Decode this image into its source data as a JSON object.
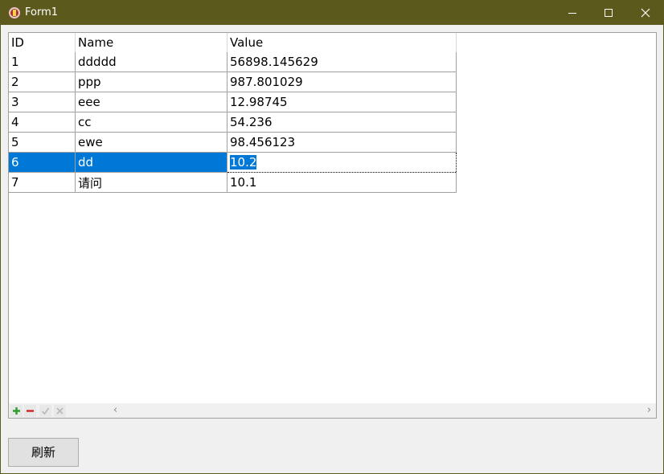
{
  "window": {
    "title": "Form1"
  },
  "grid": {
    "columns": [
      "ID",
      "Name",
      "Value"
    ],
    "rows": [
      {
        "id": "1",
        "name": "ddddd",
        "value": "56898.145629"
      },
      {
        "id": "2",
        "name": "ppp",
        "value": "987.801029"
      },
      {
        "id": "3",
        "name": "eee",
        "value": "12.98745"
      },
      {
        "id": "4",
        "name": "cc",
        "value": "54.236"
      },
      {
        "id": "5",
        "name": "ewe",
        "value": "98.456123"
      },
      {
        "id": "6",
        "name": "dd",
        "value": "10.2"
      },
      {
        "id": "7",
        "name": "请问",
        "value": "10.1"
      }
    ],
    "selected_row_index": 5,
    "selection_color": "#0078d7"
  },
  "navigator": {
    "icons": [
      "add-record-icon",
      "delete-record-icon",
      "post-record-icon",
      "cancel-edit-icon"
    ]
  },
  "scrollbar": {
    "left_arrow": "‹",
    "right_arrow": "›"
  },
  "buttons": {
    "refresh_label": "刷新"
  },
  "colors": {
    "titlebar": "#5c591d",
    "accent": "#0078d7"
  }
}
